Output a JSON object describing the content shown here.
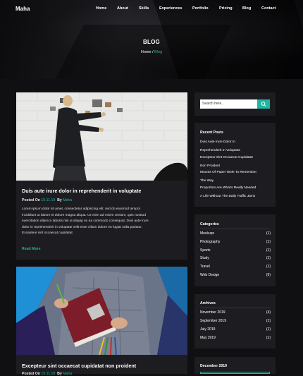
{
  "brand": "Maha",
  "nav": [
    "Home",
    "About",
    "Skills",
    "Experiences",
    "Portfolio",
    "Pricing",
    "Blog",
    "Contact"
  ],
  "hero": {
    "title": "BLOG",
    "breadcrumb_home": "Home",
    "breadcrumb_sep": "/",
    "breadcrumb_current": "Blog"
  },
  "posts": [
    {
      "title": "Duis aute irure dolor in reprehenderit in voluptate",
      "posted_on_label": "Posted On",
      "date": "19.11.19",
      "by_label": "By",
      "author": "Maha",
      "excerpt_lines": [
        "Lorem ipsum dolor sit amet, consectetur adipiscing elit, sed do eiusmod tempor",
        "incididunt ut labore et dolore magna aliqua. Ut enim ad minim veniam, quis nostrud",
        "exercitation ullamco laboris nisi ut aliquip ex ea commodo consequat. Duis aute irure",
        "dolor in reprehenderit in voluptate velit esse cillum dolore eu fugiat nulla pariatur.",
        "Excepteur sint occaecat cupidatat."
      ],
      "read_more": "Read More"
    },
    {
      "title": "Excepteur sint occaecat cupidatat non proident",
      "posted_on_label": "Posted On",
      "date": "19.11.19",
      "by_label": "By",
      "author": "Maha"
    }
  ],
  "sidebar": {
    "search": {
      "placeholder": "Search here.."
    },
    "recent_posts": {
      "title": "Recent Posts",
      "items": [
        [
          "Duis Aute Irure Dolor In",
          "Reprehenderit In Voluptate"
        ],
        [
          "Excepteur Sint Occaecat Cupidatat",
          "Non Proident"
        ],
        [
          "Mounts Of Paper Work To Remember",
          "The Way"
        ],
        [
          "Proportion Are What's Really Needed",
          "A Life Without The Daily Traffic Jams"
        ]
      ]
    },
    "categories": {
      "title": "Categories",
      "items": [
        {
          "name": "Mockups",
          "count": "(1)"
        },
        {
          "name": "Photography",
          "count": "(1)"
        },
        {
          "name": "Sports",
          "count": "(1)"
        },
        {
          "name": "Study",
          "count": "(1)"
        },
        {
          "name": "Travel",
          "count": "(1)"
        },
        {
          "name": "Web Design",
          "count": "(6)"
        }
      ]
    },
    "archives": {
      "title": "Archives",
      "items": [
        {
          "name": "November 2019",
          "count": "(4)"
        },
        {
          "name": "September 2019",
          "count": "(1)"
        },
        {
          "name": "July 2019",
          "count": "(1)"
        },
        {
          "name": "May 2019",
          "count": "(1)"
        }
      ]
    },
    "calendar": {
      "title": "December 2019"
    }
  },
  "colors": {
    "accent": "#1fb6a3",
    "card": "#1d1d21",
    "background": "#101012"
  }
}
